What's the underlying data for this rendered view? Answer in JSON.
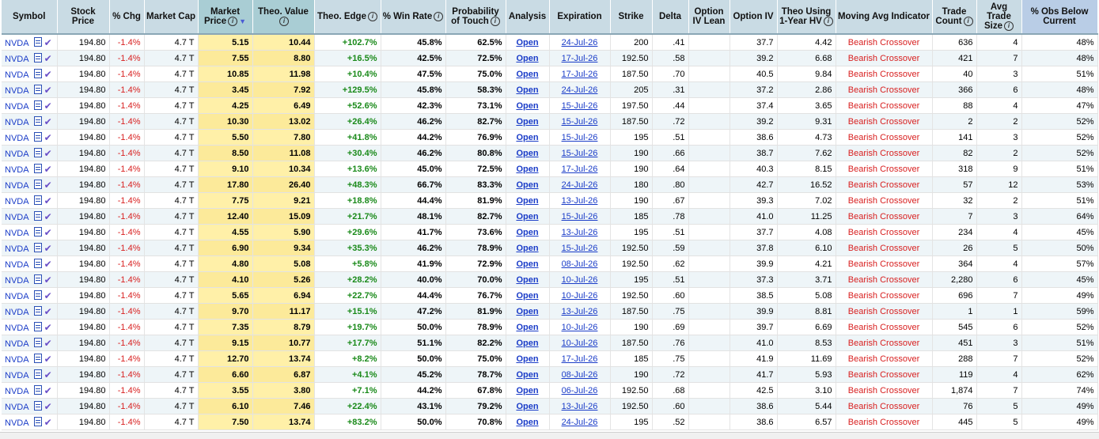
{
  "columns": [
    {
      "label": "Symbol",
      "info": false
    },
    {
      "label": "Stock Price",
      "info": false
    },
    {
      "label": "% Chg",
      "info": false
    },
    {
      "label": "Market Cap",
      "info": false
    },
    {
      "label": "Market Price",
      "info": true
    },
    {
      "label": "Theo. Value",
      "info": true
    },
    {
      "label": "Theo. Edge",
      "info": true
    },
    {
      "label": "% Win Rate",
      "info": true
    },
    {
      "label": "Probability of Touch",
      "info": true
    },
    {
      "label": "Analysis",
      "info": false
    },
    {
      "label": "Expiration",
      "info": false
    },
    {
      "label": "Strike",
      "info": false
    },
    {
      "label": "Delta",
      "info": false
    },
    {
      "label": "Option IV Lean",
      "info": false
    },
    {
      "label": "Option IV",
      "info": false
    },
    {
      "label": "Theo Using 1-Year HV",
      "info": true
    },
    {
      "label": "Moving Avg Indicator",
      "info": false
    },
    {
      "label": "Trade Count",
      "info": true
    },
    {
      "label": "Avg Trade Size",
      "info": true
    },
    {
      "label": "% Obs Below Current",
      "info": false
    }
  ],
  "sort_indicator": "▼",
  "rows": [
    {
      "symbol": "NVDA",
      "stock_price": "194.80",
      "chg": "-1.4%",
      "mcap": "4.7 T",
      "market_price": "5.15",
      "theo_value": "10.44",
      "theo_edge": "+102.7%",
      "win_rate": "45.8%",
      "pot": "62.5%",
      "analysis": "Open",
      "expiration": "24-Jul-26",
      "strike": "200",
      "delta": ".41",
      "iv_lean": "",
      "iv": "37.7",
      "theo_hv": "4.42",
      "ma": "Bearish Crossover",
      "trade_count": "636",
      "avg_size": "4",
      "obs_below": "48%"
    },
    {
      "symbol": "NVDA",
      "stock_price": "194.80",
      "chg": "-1.4%",
      "mcap": "4.7 T",
      "market_price": "7.55",
      "theo_value": "8.80",
      "theo_edge": "+16.5%",
      "win_rate": "42.5%",
      "pot": "72.5%",
      "analysis": "Open",
      "expiration": "17-Jul-26",
      "strike": "192.50",
      "delta": ".58",
      "iv_lean": "",
      "iv": "39.2",
      "theo_hv": "6.68",
      "ma": "Bearish Crossover",
      "trade_count": "421",
      "avg_size": "7",
      "obs_below": "48%"
    },
    {
      "symbol": "NVDA",
      "stock_price": "194.80",
      "chg": "-1.4%",
      "mcap": "4.7 T",
      "market_price": "10.85",
      "theo_value": "11.98",
      "theo_edge": "+10.4%",
      "win_rate": "47.5%",
      "pot": "75.0%",
      "analysis": "Open",
      "expiration": "17-Jul-26",
      "strike": "187.50",
      "delta": ".70",
      "iv_lean": "",
      "iv": "40.5",
      "theo_hv": "9.84",
      "ma": "Bearish Crossover",
      "trade_count": "40",
      "avg_size": "3",
      "obs_below": "51%"
    },
    {
      "symbol": "NVDA",
      "stock_price": "194.80",
      "chg": "-1.4%",
      "mcap": "4.7 T",
      "market_price": "3.45",
      "theo_value": "7.92",
      "theo_edge": "+129.5%",
      "win_rate": "45.8%",
      "pot": "58.3%",
      "analysis": "Open",
      "expiration": "24-Jul-26",
      "strike": "205",
      "delta": ".31",
      "iv_lean": "",
      "iv": "37.2",
      "theo_hv": "2.86",
      "ma": "Bearish Crossover",
      "trade_count": "366",
      "avg_size": "6",
      "obs_below": "48%"
    },
    {
      "symbol": "NVDA",
      "stock_price": "194.80",
      "chg": "-1.4%",
      "mcap": "4.7 T",
      "market_price": "4.25",
      "theo_value": "6.49",
      "theo_edge": "+52.6%",
      "win_rate": "42.3%",
      "pot": "73.1%",
      "analysis": "Open",
      "expiration": "15-Jul-26",
      "strike": "197.50",
      "delta": ".44",
      "iv_lean": "",
      "iv": "37.4",
      "theo_hv": "3.65",
      "ma": "Bearish Crossover",
      "trade_count": "88",
      "avg_size": "4",
      "obs_below": "47%"
    },
    {
      "symbol": "NVDA",
      "stock_price": "194.80",
      "chg": "-1.4%",
      "mcap": "4.7 T",
      "market_price": "10.30",
      "theo_value": "13.02",
      "theo_edge": "+26.4%",
      "win_rate": "46.2%",
      "pot": "82.7%",
      "analysis": "Open",
      "expiration": "15-Jul-26",
      "strike": "187.50",
      "delta": ".72",
      "iv_lean": "",
      "iv": "39.2",
      "theo_hv": "9.31",
      "ma": "Bearish Crossover",
      "trade_count": "2",
      "avg_size": "2",
      "obs_below": "52%"
    },
    {
      "symbol": "NVDA",
      "stock_price": "194.80",
      "chg": "-1.4%",
      "mcap": "4.7 T",
      "market_price": "5.50",
      "theo_value": "7.80",
      "theo_edge": "+41.8%",
      "win_rate": "44.2%",
      "pot": "76.9%",
      "analysis": "Open",
      "expiration": "15-Jul-26",
      "strike": "195",
      "delta": ".51",
      "iv_lean": "",
      "iv": "38.6",
      "theo_hv": "4.73",
      "ma": "Bearish Crossover",
      "trade_count": "141",
      "avg_size": "3",
      "obs_below": "52%"
    },
    {
      "symbol": "NVDA",
      "stock_price": "194.80",
      "chg": "-1.4%",
      "mcap": "4.7 T",
      "market_price": "8.50",
      "theo_value": "11.08",
      "theo_edge": "+30.4%",
      "win_rate": "46.2%",
      "pot": "80.8%",
      "analysis": "Open",
      "expiration": "15-Jul-26",
      "strike": "190",
      "delta": ".66",
      "iv_lean": "",
      "iv": "38.7",
      "theo_hv": "7.62",
      "ma": "Bearish Crossover",
      "trade_count": "82",
      "avg_size": "2",
      "obs_below": "52%"
    },
    {
      "symbol": "NVDA",
      "stock_price": "194.80",
      "chg": "-1.4%",
      "mcap": "4.7 T",
      "market_price": "9.10",
      "theo_value": "10.34",
      "theo_edge": "+13.6%",
      "win_rate": "45.0%",
      "pot": "72.5%",
      "analysis": "Open",
      "expiration": "17-Jul-26",
      "strike": "190",
      "delta": ".64",
      "iv_lean": "",
      "iv": "40.3",
      "theo_hv": "8.15",
      "ma": "Bearish Crossover",
      "trade_count": "318",
      "avg_size": "9",
      "obs_below": "51%"
    },
    {
      "symbol": "NVDA",
      "stock_price": "194.80",
      "chg": "-1.4%",
      "mcap": "4.7 T",
      "market_price": "17.80",
      "theo_value": "26.40",
      "theo_edge": "+48.3%",
      "win_rate": "66.7%",
      "pot": "83.3%",
      "analysis": "Open",
      "expiration": "24-Jul-26",
      "strike": "180",
      "delta": ".80",
      "iv_lean": "",
      "iv": "42.7",
      "theo_hv": "16.52",
      "ma": "Bearish Crossover",
      "trade_count": "57",
      "avg_size": "12",
      "obs_below": "53%"
    },
    {
      "symbol": "NVDA",
      "stock_price": "194.80",
      "chg": "-1.4%",
      "mcap": "4.7 T",
      "market_price": "7.75",
      "theo_value": "9.21",
      "theo_edge": "+18.8%",
      "win_rate": "44.4%",
      "pot": "81.9%",
      "analysis": "Open",
      "expiration": "13-Jul-26",
      "strike": "190",
      "delta": ".67",
      "iv_lean": "",
      "iv": "39.3",
      "theo_hv": "7.02",
      "ma": "Bearish Crossover",
      "trade_count": "32",
      "avg_size": "2",
      "obs_below": "51%"
    },
    {
      "symbol": "NVDA",
      "stock_price": "194.80",
      "chg": "-1.4%",
      "mcap": "4.7 T",
      "market_price": "12.40",
      "theo_value": "15.09",
      "theo_edge": "+21.7%",
      "win_rate": "48.1%",
      "pot": "82.7%",
      "analysis": "Open",
      "expiration": "15-Jul-26",
      "strike": "185",
      "delta": ".78",
      "iv_lean": "",
      "iv": "41.0",
      "theo_hv": "11.25",
      "ma": "Bearish Crossover",
      "trade_count": "7",
      "avg_size": "3",
      "obs_below": "64%"
    },
    {
      "symbol": "NVDA",
      "stock_price": "194.80",
      "chg": "-1.4%",
      "mcap": "4.7 T",
      "market_price": "4.55",
      "theo_value": "5.90",
      "theo_edge": "+29.6%",
      "win_rate": "41.7%",
      "pot": "73.6%",
      "analysis": "Open",
      "expiration": "13-Jul-26",
      "strike": "195",
      "delta": ".51",
      "iv_lean": "",
      "iv": "37.7",
      "theo_hv": "4.08",
      "ma": "Bearish Crossover",
      "trade_count": "234",
      "avg_size": "4",
      "obs_below": "45%"
    },
    {
      "symbol": "NVDA",
      "stock_price": "194.80",
      "chg": "-1.4%",
      "mcap": "4.7 T",
      "market_price": "6.90",
      "theo_value": "9.34",
      "theo_edge": "+35.3%",
      "win_rate": "46.2%",
      "pot": "78.9%",
      "analysis": "Open",
      "expiration": "15-Jul-26",
      "strike": "192.50",
      "delta": ".59",
      "iv_lean": "",
      "iv": "37.8",
      "theo_hv": "6.10",
      "ma": "Bearish Crossover",
      "trade_count": "26",
      "avg_size": "5",
      "obs_below": "50%"
    },
    {
      "symbol": "NVDA",
      "stock_price": "194.80",
      "chg": "-1.4%",
      "mcap": "4.7 T",
      "market_price": "4.80",
      "theo_value": "5.08",
      "theo_edge": "+5.8%",
      "win_rate": "41.9%",
      "pot": "72.9%",
      "analysis": "Open",
      "expiration": "08-Jul-26",
      "strike": "192.50",
      "delta": ".62",
      "iv_lean": "",
      "iv": "39.9",
      "theo_hv": "4.21",
      "ma": "Bearish Crossover",
      "trade_count": "364",
      "avg_size": "4",
      "obs_below": "57%"
    },
    {
      "symbol": "NVDA",
      "stock_price": "194.80",
      "chg": "-1.4%",
      "mcap": "4.7 T",
      "market_price": "4.10",
      "theo_value": "5.26",
      "theo_edge": "+28.2%",
      "win_rate": "40.0%",
      "pot": "70.0%",
      "analysis": "Open",
      "expiration": "10-Jul-26",
      "strike": "195",
      "delta": ".51",
      "iv_lean": "",
      "iv": "37.3",
      "theo_hv": "3.71",
      "ma": "Bearish Crossover",
      "trade_count": "2,280",
      "avg_size": "6",
      "obs_below": "45%"
    },
    {
      "symbol": "NVDA",
      "stock_price": "194.80",
      "chg": "-1.4%",
      "mcap": "4.7 T",
      "market_price": "5.65",
      "theo_value": "6.94",
      "theo_edge": "+22.7%",
      "win_rate": "44.4%",
      "pot": "76.7%",
      "analysis": "Open",
      "expiration": "10-Jul-26",
      "strike": "192.50",
      "delta": ".60",
      "iv_lean": "",
      "iv": "38.5",
      "theo_hv": "5.08",
      "ma": "Bearish Crossover",
      "trade_count": "696",
      "avg_size": "7",
      "obs_below": "49%"
    },
    {
      "symbol": "NVDA",
      "stock_price": "194.80",
      "chg": "-1.4%",
      "mcap": "4.7 T",
      "market_price": "9.70",
      "theo_value": "11.17",
      "theo_edge": "+15.1%",
      "win_rate": "47.2%",
      "pot": "81.9%",
      "analysis": "Open",
      "expiration": "13-Jul-26",
      "strike": "187.50",
      "delta": ".75",
      "iv_lean": "",
      "iv": "39.9",
      "theo_hv": "8.81",
      "ma": "Bearish Crossover",
      "trade_count": "1",
      "avg_size": "1",
      "obs_below": "59%"
    },
    {
      "symbol": "NVDA",
      "stock_price": "194.80",
      "chg": "-1.4%",
      "mcap": "4.7 T",
      "market_price": "7.35",
      "theo_value": "8.79",
      "theo_edge": "+19.7%",
      "win_rate": "50.0%",
      "pot": "78.9%",
      "analysis": "Open",
      "expiration": "10-Jul-26",
      "strike": "190",
      "delta": ".69",
      "iv_lean": "",
      "iv": "39.7",
      "theo_hv": "6.69",
      "ma": "Bearish Crossover",
      "trade_count": "545",
      "avg_size": "6",
      "obs_below": "52%"
    },
    {
      "symbol": "NVDA",
      "stock_price": "194.80",
      "chg": "-1.4%",
      "mcap": "4.7 T",
      "market_price": "9.15",
      "theo_value": "10.77",
      "theo_edge": "+17.7%",
      "win_rate": "51.1%",
      "pot": "82.2%",
      "analysis": "Open",
      "expiration": "10-Jul-26",
      "strike": "187.50",
      "delta": ".76",
      "iv_lean": "",
      "iv": "41.0",
      "theo_hv": "8.53",
      "ma": "Bearish Crossover",
      "trade_count": "451",
      "avg_size": "3",
      "obs_below": "51%"
    },
    {
      "symbol": "NVDA",
      "stock_price": "194.80",
      "chg": "-1.4%",
      "mcap": "4.7 T",
      "market_price": "12.70",
      "theo_value": "13.74",
      "theo_edge": "+8.2%",
      "win_rate": "50.0%",
      "pot": "75.0%",
      "analysis": "Open",
      "expiration": "17-Jul-26",
      "strike": "185",
      "delta": ".75",
      "iv_lean": "",
      "iv": "41.9",
      "theo_hv": "11.69",
      "ma": "Bearish Crossover",
      "trade_count": "288",
      "avg_size": "7",
      "obs_below": "52%"
    },
    {
      "symbol": "NVDA",
      "stock_price": "194.80",
      "chg": "-1.4%",
      "mcap": "4.7 T",
      "market_price": "6.60",
      "theo_value": "6.87",
      "theo_edge": "+4.1%",
      "win_rate": "45.2%",
      "pot": "78.7%",
      "analysis": "Open",
      "expiration": "08-Jul-26",
      "strike": "190",
      "delta": ".72",
      "iv_lean": "",
      "iv": "41.7",
      "theo_hv": "5.93",
      "ma": "Bearish Crossover",
      "trade_count": "119",
      "avg_size": "4",
      "obs_below": "62%"
    },
    {
      "symbol": "NVDA",
      "stock_price": "194.80",
      "chg": "-1.4%",
      "mcap": "4.7 T",
      "market_price": "3.55",
      "theo_value": "3.80",
      "theo_edge": "+7.1%",
      "win_rate": "44.2%",
      "pot": "67.8%",
      "analysis": "Open",
      "expiration": "06-Jul-26",
      "strike": "192.50",
      "delta": ".68",
      "iv_lean": "",
      "iv": "42.5",
      "theo_hv": "3.10",
      "ma": "Bearish Crossover",
      "trade_count": "1,874",
      "avg_size": "7",
      "obs_below": "74%"
    },
    {
      "symbol": "NVDA",
      "stock_price": "194.80",
      "chg": "-1.4%",
      "mcap": "4.7 T",
      "market_price": "6.10",
      "theo_value": "7.46",
      "theo_edge": "+22.4%",
      "win_rate": "43.1%",
      "pot": "79.2%",
      "analysis": "Open",
      "expiration": "13-Jul-26",
      "strike": "192.50",
      "delta": ".60",
      "iv_lean": "",
      "iv": "38.6",
      "theo_hv": "5.44",
      "ma": "Bearish Crossover",
      "trade_count": "76",
      "avg_size": "5",
      "obs_below": "49%"
    },
    {
      "symbol": "NVDA",
      "stock_price": "194.80",
      "chg": "-1.4%",
      "mcap": "4.7 T",
      "market_price": "7.50",
      "theo_value": "13.74",
      "theo_edge": "+83.2%",
      "win_rate": "50.0%",
      "pot": "70.8%",
      "analysis": "Open",
      "expiration": "24-Jul-26",
      "strike": "195",
      "delta": ".52",
      "iv_lean": "",
      "iv": "38.6",
      "theo_hv": "6.57",
      "ma": "Bearish Crossover",
      "trade_count": "445",
      "avg_size": "5",
      "obs_below": "49%"
    }
  ]
}
